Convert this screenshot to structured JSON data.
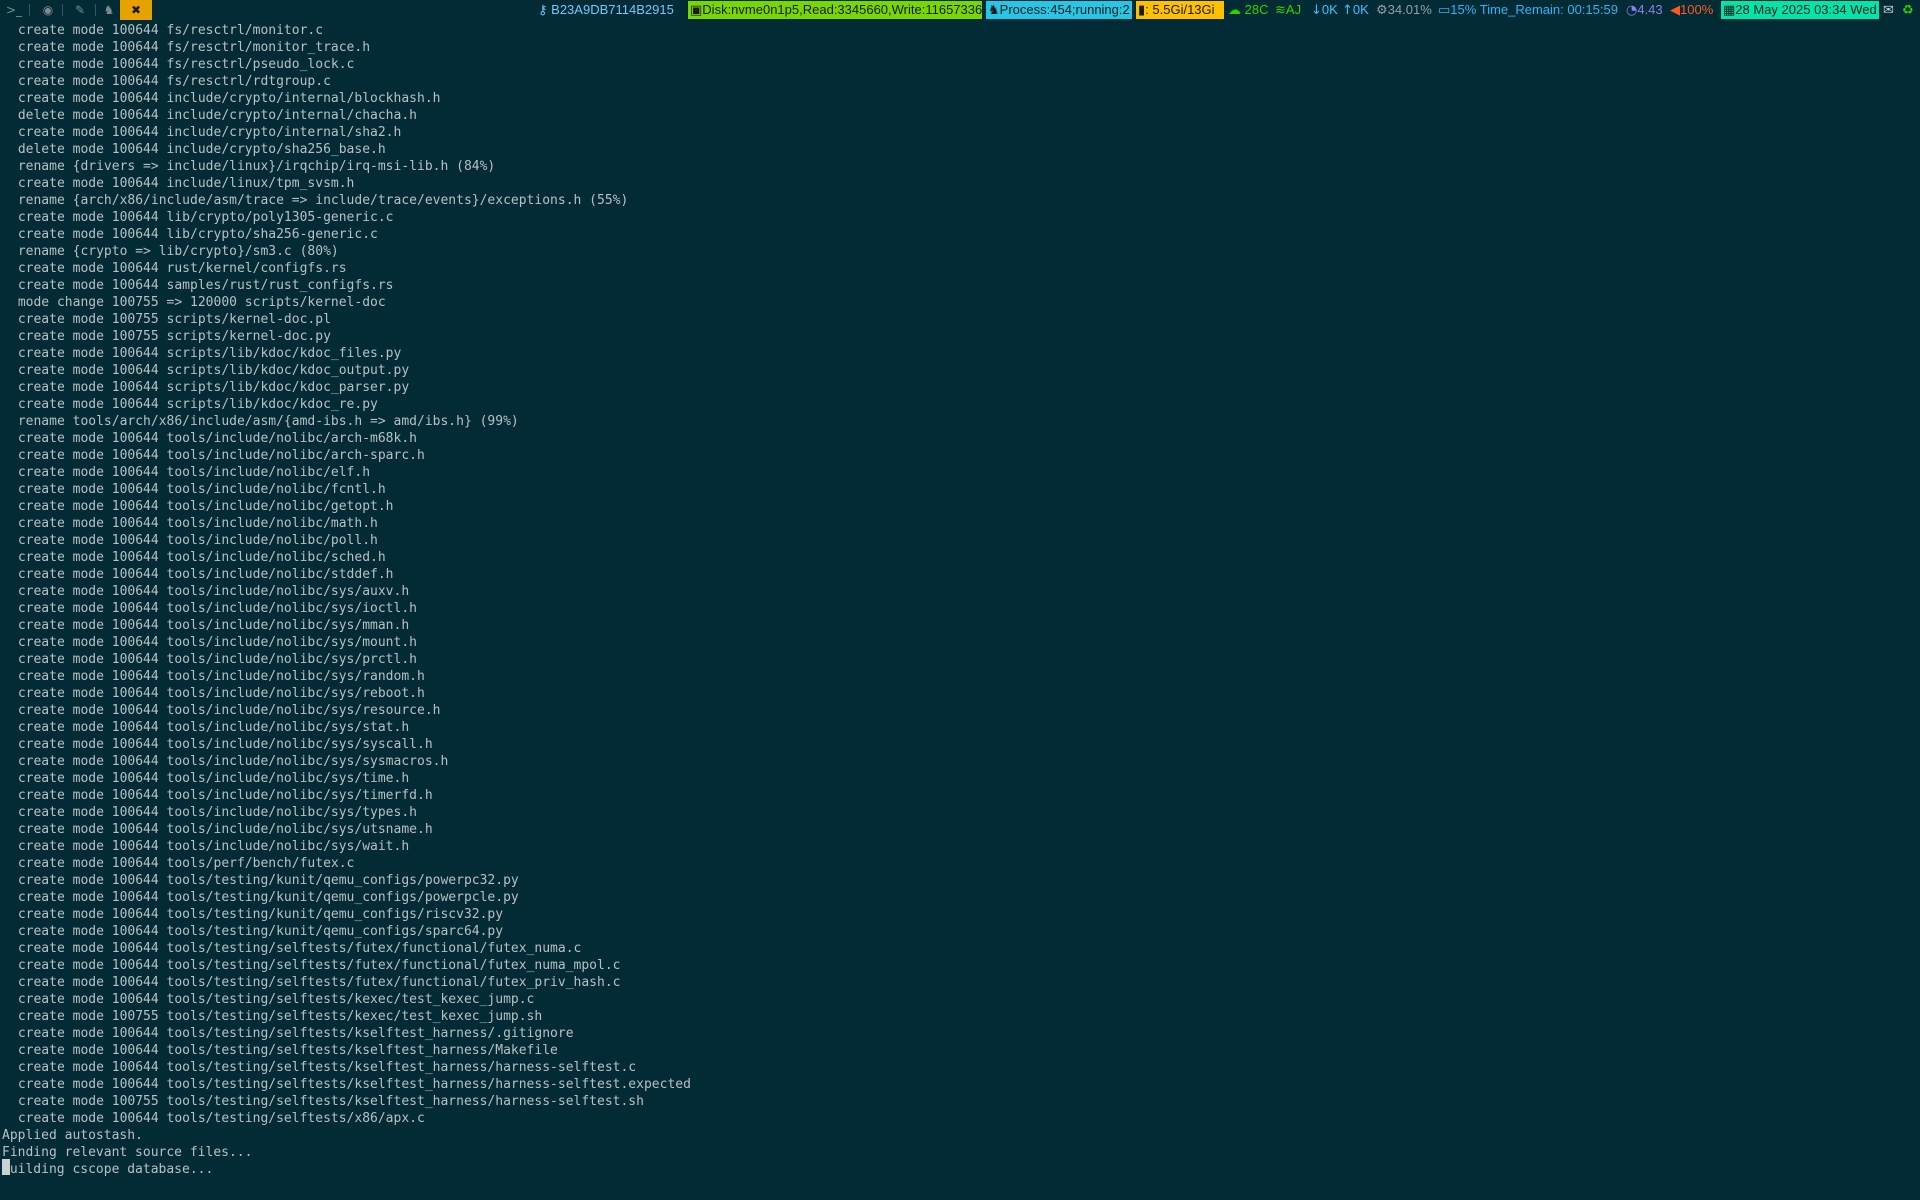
{
  "topbar": {
    "workspaces": [
      {
        "icon": "terminal-icon",
        "glyph": ">_",
        "active": false
      },
      {
        "icon": "browser-icon",
        "glyph": "◉",
        "active": false
      },
      {
        "icon": "editor-icon",
        "glyph": "✎",
        "active": false
      },
      {
        "icon": "linux-icon",
        "glyph": "♞",
        "active": false
      },
      {
        "icon": "tools-icon",
        "glyph": "✖",
        "active": true
      }
    ],
    "window_title": "B23A9DB7114B2915",
    "disk": "Disk:nvme0n1p5,Read:3345660,Write:11657336",
    "process": "Process:454;running:2",
    "memory": ": 5.5Gi/13Gi",
    "weather": "28C",
    "wifi": "AJ",
    "net_down": "0K",
    "net_up": "0K",
    "cpu": "34.01%",
    "battery": "15% Time_Remain: 00:15:59",
    "load": "4.43",
    "volume": "100%",
    "datetime": "28 May 2025 03:34 Wed",
    "colors": {
      "disk_bg": "#78d700",
      "process_bg": "#27c6e6",
      "memory_bg": "#ffc000",
      "datetime_bg": "#00e6a8",
      "weather_fg": "#2ad400",
      "wifi_fg": "#2ad400",
      "net_fg": "#34c6ff",
      "cpu_fg": "#8fa2a6",
      "battery_fg": "#29b6f6",
      "load_fg": "#8a82e8",
      "volume_fg": "#ff5a1f"
    }
  },
  "terminal": {
    "lines": [
      " create mode 100644 fs/resctrl/monitor.c",
      " create mode 100644 fs/resctrl/monitor_trace.h",
      " create mode 100644 fs/resctrl/pseudo_lock.c",
      " create mode 100644 fs/resctrl/rdtgroup.c",
      " create mode 100644 include/crypto/internal/blockhash.h",
      " delete mode 100644 include/crypto/internal/chacha.h",
      " create mode 100644 include/crypto/internal/sha2.h",
      " delete mode 100644 include/crypto/sha256_base.h",
      " rename {drivers => include/linux}/irqchip/irq-msi-lib.h (84%)",
      " create mode 100644 include/linux/tpm_svsm.h",
      " rename {arch/x86/include/asm/trace => include/trace/events}/exceptions.h (55%)",
      " create mode 100644 lib/crypto/poly1305-generic.c",
      " create mode 100644 lib/crypto/sha256-generic.c",
      " rename {crypto => lib/crypto}/sm3.c (80%)",
      " create mode 100644 rust/kernel/configfs.rs",
      " create mode 100644 samples/rust/rust_configfs.rs",
      " mode change 100755 => 120000 scripts/kernel-doc",
      " create mode 100755 scripts/kernel-doc.pl",
      " create mode 100755 scripts/kernel-doc.py",
      " create mode 100644 scripts/lib/kdoc/kdoc_files.py",
      " create mode 100644 scripts/lib/kdoc/kdoc_output.py",
      " create mode 100644 scripts/lib/kdoc/kdoc_parser.py",
      " create mode 100644 scripts/lib/kdoc/kdoc_re.py",
      " rename tools/arch/x86/include/asm/{amd-ibs.h => amd/ibs.h} (99%)",
      " create mode 100644 tools/include/nolibc/arch-m68k.h",
      " create mode 100644 tools/include/nolibc/arch-sparc.h",
      " create mode 100644 tools/include/nolibc/elf.h",
      " create mode 100644 tools/include/nolibc/fcntl.h",
      " create mode 100644 tools/include/nolibc/getopt.h",
      " create mode 100644 tools/include/nolibc/math.h",
      " create mode 100644 tools/include/nolibc/poll.h",
      " create mode 100644 tools/include/nolibc/sched.h",
      " create mode 100644 tools/include/nolibc/stddef.h",
      " create mode 100644 tools/include/nolibc/sys/auxv.h",
      " create mode 100644 tools/include/nolibc/sys/ioctl.h",
      " create mode 100644 tools/include/nolibc/sys/mman.h",
      " create mode 100644 tools/include/nolibc/sys/mount.h",
      " create mode 100644 tools/include/nolibc/sys/prctl.h",
      " create mode 100644 tools/include/nolibc/sys/random.h",
      " create mode 100644 tools/include/nolibc/sys/reboot.h",
      " create mode 100644 tools/include/nolibc/sys/resource.h",
      " create mode 100644 tools/include/nolibc/sys/stat.h",
      " create mode 100644 tools/include/nolibc/sys/syscall.h",
      " create mode 100644 tools/include/nolibc/sys/sysmacros.h",
      " create mode 100644 tools/include/nolibc/sys/time.h",
      " create mode 100644 tools/include/nolibc/sys/timerfd.h",
      " create mode 100644 tools/include/nolibc/sys/types.h",
      " create mode 100644 tools/include/nolibc/sys/utsname.h",
      " create mode 100644 tools/include/nolibc/sys/wait.h",
      " create mode 100644 tools/perf/bench/futex.c",
      " create mode 100644 tools/testing/kunit/qemu_configs/powerpc32.py",
      " create mode 100644 tools/testing/kunit/qemu_configs/powerpcle.py",
      " create mode 100644 tools/testing/kunit/qemu_configs/riscv32.py",
      " create mode 100644 tools/testing/kunit/qemu_configs/sparc64.py",
      " create mode 100644 tools/testing/selftests/futex/functional/futex_numa.c",
      " create mode 100644 tools/testing/selftests/futex/functional/futex_numa_mpol.c",
      " create mode 100644 tools/testing/selftests/futex/functional/futex_priv_hash.c",
      " create mode 100644 tools/testing/selftests/kexec/test_kexec_jump.c",
      " create mode 100755 tools/testing/selftests/kexec/test_kexec_jump.sh",
      " create mode 100644 tools/testing/selftests/kselftest_harness/.gitignore",
      " create mode 100644 tools/testing/selftests/kselftest_harness/Makefile",
      " create mode 100644 tools/testing/selftests/kselftest_harness/harness-selftest.c",
      " create mode 100644 tools/testing/selftests/kselftest_harness/harness-selftest.expected",
      " create mode 100755 tools/testing/selftests/kselftest_harness/harness-selftest.sh",
      " create mode 100644 tools/testing/selftests/x86/apx.c",
      "Applied autostash.",
      "Finding relevant source files...",
      "Building cscope database..."
    ]
  }
}
